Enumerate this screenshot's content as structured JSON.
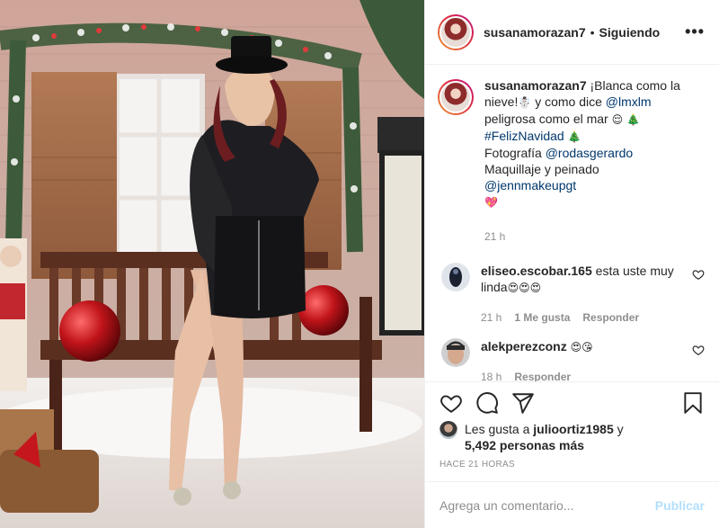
{
  "post": {
    "username": "susanamorazan7",
    "separator": "•",
    "follow_status": "Siguiendo",
    "more_label": "•••"
  },
  "caption": {
    "username": "susanamorazan7",
    "line1_text": "¡Blanca como la nieve!",
    "snowman_emoji": "☃️",
    "line2_text": " y como dice ",
    "mention_lmxlm": "@lmxlm",
    "line3_text": "peligrosa como el mar ",
    "relieved_emoji": "😌",
    "tree_emoji": "🎄",
    "hashtag": "#FelizNavidad",
    "photo_label": "Fotografía ",
    "mention_photo": "@rodasgerardo",
    "makeup_label": "Maquillaje y peinado ",
    "mention_makeup": "@jennmakeupgt",
    "heart_emoji": "💖",
    "time": "21 h"
  },
  "comments": [
    {
      "username": "eliseo.escobar.165",
      "text": "esta uste muy linda",
      "emojis": "😍😍😍",
      "time": "21 h",
      "likes": "1 Me gusta",
      "reply": "Responder"
    },
    {
      "username": "alekperezconz",
      "text": "",
      "emojis": "😍😘",
      "time": "18 h",
      "reply": "Responder"
    }
  ],
  "likes": {
    "prefix": "Les gusta a ",
    "user": "julioortiz1985",
    "connector": " y",
    "others": "5,492 personas más"
  },
  "timestamp": "HACE 21 HORAS",
  "add_comment": {
    "placeholder": "Agrega un comentario...",
    "publish": "Publicar"
  },
  "icons": {
    "like": "heart-icon",
    "comment": "comment-icon",
    "share": "share-icon",
    "save": "bookmark-icon",
    "comment_like": "heart-icon",
    "more": "more-icon"
  },
  "colors": {
    "link": "#00376b",
    "muted": "#8e8e8e",
    "publish_disabled": "#b2dffc",
    "divider": "#efefef"
  }
}
